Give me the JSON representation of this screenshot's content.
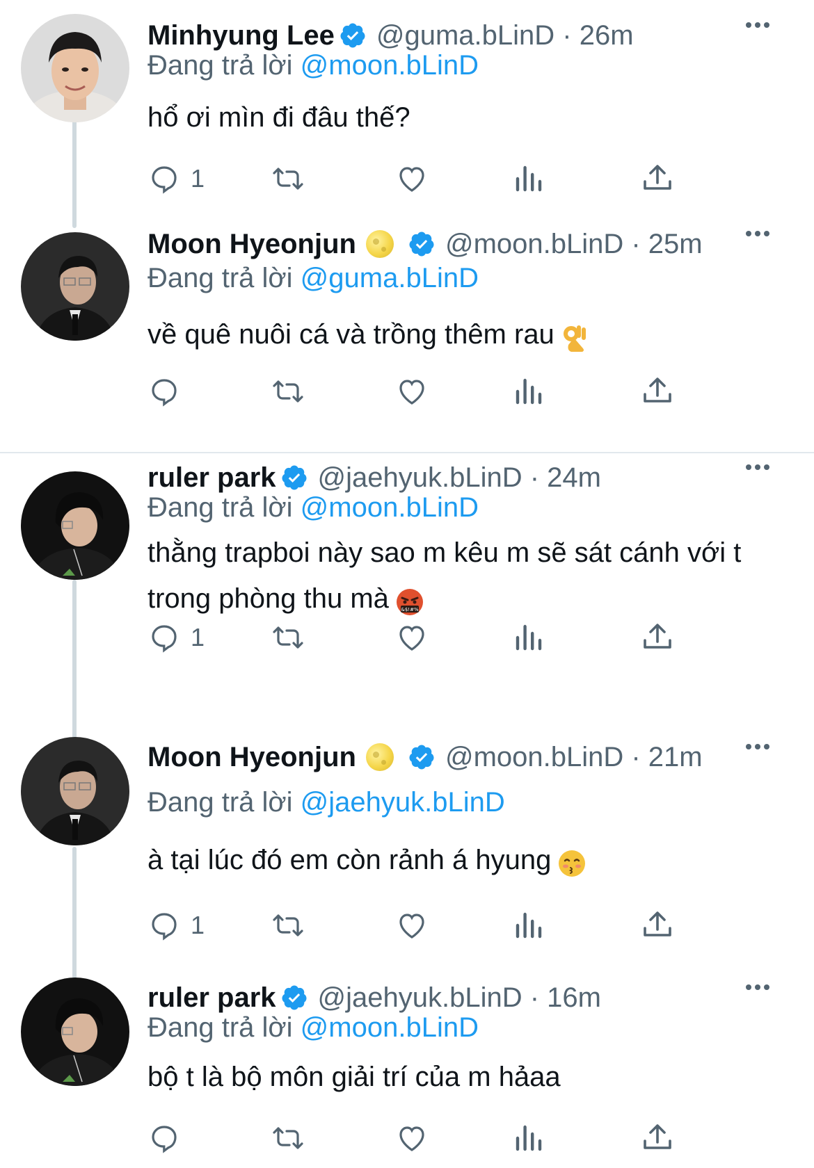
{
  "labels": {
    "replying_prefix": "Đang trả lời"
  },
  "tweets": [
    {
      "name": "Minhyung Lee",
      "handle": "@guma.bLinD",
      "time": "26m",
      "handle_time": "@guma.bLinD · 26m",
      "replying_to": "@moon.bLinD",
      "text": "hổ ơi mìn đi đâu thế?",
      "emoji": "",
      "reply_count": "1"
    },
    {
      "name": "Moon Hyeonjun",
      "handle": "@moon.bLinD",
      "time": "25m",
      "handle_time": "@moon.bLinD · 25m",
      "replying_to": "@guma.bLinD",
      "text": "về quê nuôi cá và trồng thêm rau",
      "emoji": "ok-hand",
      "reply_count": ""
    },
    {
      "name": "ruler park",
      "handle": "@jaehyuk.bLinD",
      "time": "24m",
      "handle_time": "@jaehyuk.bLinD · 24m",
      "replying_to": "@moon.bLinD",
      "text": "thằng trapboi này sao m kêu m sẽ sát cánh với t trong phòng thu mà",
      "emoji": "cursing-face",
      "reply_count": "1"
    },
    {
      "name": "Moon Hyeonjun",
      "handle": "@moon.bLinD",
      "time": "21m",
      "handle_time": "@moon.bLinD · 21m",
      "replying_to": "@jaehyuk.bLinD",
      "text": "à tại lúc đó em còn rảnh á hyung",
      "emoji": "kissing-face",
      "reply_count": "1"
    },
    {
      "name": "ruler park",
      "handle": "@jaehyuk.bLinD",
      "time": "16m",
      "handle_time": "@jaehyuk.bLinD · 16m",
      "replying_to": "@moon.bLinD",
      "text": "bộ t là bộ môn giải trí của m hảaa",
      "emoji": "",
      "reply_count": ""
    }
  ],
  "colors": {
    "text": "#0f1419",
    "secondary": "#536471",
    "link": "#1d9bf0",
    "verified": "#1d9bf0",
    "divider": "#e1e8ed",
    "thread_line": "#cfd9de"
  },
  "icons": {
    "verified": "verified-badge-icon",
    "more": "more-options-icon",
    "reply": "reply-icon",
    "retweet": "retweet-icon",
    "like": "like-heart-icon",
    "views": "views-analytics-icon",
    "share": "share-icon",
    "moon": "full-moon-emoji"
  }
}
